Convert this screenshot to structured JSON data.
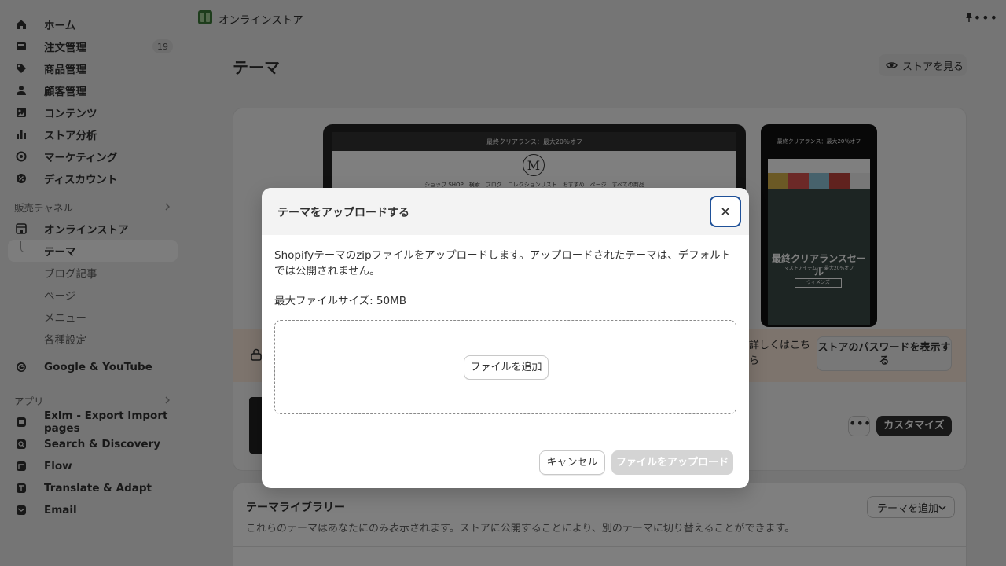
{
  "sidebar": {
    "items": [
      {
        "label": "ホーム",
        "icon": "home-icon"
      },
      {
        "label": "注文管理",
        "icon": "inbox-icon",
        "badge": "19"
      },
      {
        "label": "商品管理",
        "icon": "tag-icon"
      },
      {
        "label": "顧客管理",
        "icon": "person-icon"
      },
      {
        "label": "コンテンツ",
        "icon": "image-icon"
      },
      {
        "label": "ストア分析",
        "icon": "bar-chart-icon"
      },
      {
        "label": "マーケティング",
        "icon": "target-icon"
      },
      {
        "label": "ディスカウント",
        "icon": "discount-icon"
      }
    ],
    "sales_channels_label": "販売チャネル",
    "online_store": {
      "label": "オンラインストア",
      "icon": "store-icon"
    },
    "online_store_sub": [
      {
        "label": "テーマ"
      },
      {
        "label": "ブログ記事"
      },
      {
        "label": "ページ"
      },
      {
        "label": "メニュー"
      },
      {
        "label": "各種設定"
      }
    ],
    "google": {
      "label": "Google & YouTube",
      "icon": "google-icon"
    },
    "apps_label": "アプリ",
    "apps": [
      {
        "label": "Exlm - Export Import pages",
        "icon": "app-icon"
      },
      {
        "label": "Search & Discovery",
        "icon": "search-icon"
      },
      {
        "label": "Flow",
        "icon": "flow-icon"
      },
      {
        "label": "Translate & Adapt",
        "icon": "translate-icon"
      },
      {
        "label": "Email",
        "icon": "email-icon"
      }
    ]
  },
  "topbar": {
    "store_name": "オンラインストア"
  },
  "page": {
    "title": "テーマ",
    "view_store_label": "ストアを見る"
  },
  "theme_card": {
    "laptop_bar_text": "最終クリアランス：最大20％オフ",
    "laptop_menu_text": "ショップ SHOP　検索　ブログ　コレクションリスト　おすすめ　ページ　すべての商品",
    "phone_bar_text": "最終クリアランス：最大20％オフ",
    "phone_title": "最終クリアランスセール",
    "phone_sub": "マストアイテム ー 最大20%オフ",
    "phone_btn": "ウィメンズ",
    "password_text": "詳しくはこちら",
    "password_button": "ストアのパスワードを表示する",
    "customize_label": "カスタマイズ",
    "more_label": "•••"
  },
  "library": {
    "title": "テーマライブラリー",
    "description": "これらのテーマはあなたにのみ表示されます。ストアに公開することにより、別のテーマに切り替えることができます。",
    "add_theme_label": "テーマを追加"
  },
  "modal": {
    "title": "テーマをアップロードする",
    "description": "Shopifyテーマのzipファイルをアップロードします。アップロードされたテーマは、デフォルトでは公開されません。",
    "max_size": "最大ファイルサイズ: 50MB",
    "add_file_label": "ファイルを追加",
    "cancel_label": "キャンセル",
    "upload_label": "ファイルをアップロード"
  },
  "colors": {
    "accent_focus": "#1f5199",
    "primary_button": "#303030",
    "disabled_button": "#d4d4d4",
    "banner": "#fbe9db"
  }
}
